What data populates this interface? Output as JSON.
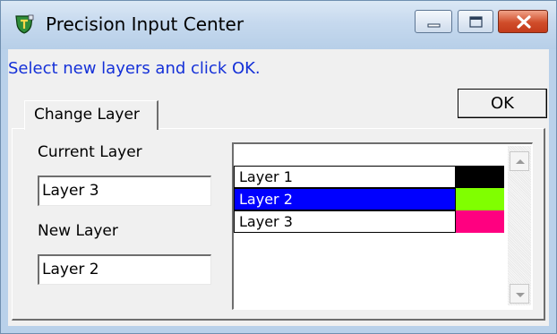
{
  "window": {
    "title": "Precision Input Center",
    "controls": {
      "minimize": "minimize",
      "maximize": "maximize",
      "close": "close"
    }
  },
  "instruction": "Select new layers and click OK.",
  "ok_button": "OK",
  "tab": {
    "label": "Change Layer"
  },
  "current_layer": {
    "label": "Current Layer",
    "value": "Layer 3"
  },
  "new_layer": {
    "label": "New Layer",
    "value": "Layer 2"
  },
  "layers": [
    {
      "name": "Layer 1",
      "color": "#000000",
      "selected": false
    },
    {
      "name": "Layer 2",
      "color": "#80ff00",
      "selected": true
    },
    {
      "name": "Layer 3",
      "color": "#ff0080",
      "selected": false
    }
  ],
  "icons": {
    "app": "shield-icon",
    "scroll_up": "arrow-up-icon",
    "scroll_down": "arrow-down-icon"
  }
}
